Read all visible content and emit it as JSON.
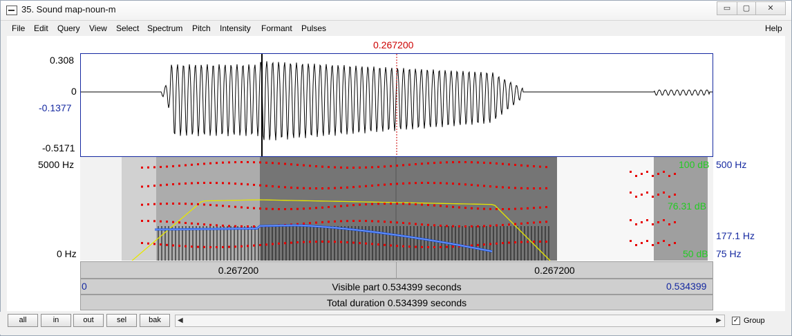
{
  "window": {
    "title": "35. Sound map-noun-m",
    "minimize_label": "▭",
    "maximize_label": "▢",
    "close_label": "✕"
  },
  "menu": {
    "items": [
      "File",
      "Edit",
      "Query",
      "View",
      "Select",
      "Spectrum",
      "Pitch",
      "Intensity",
      "Formant",
      "Pulses"
    ],
    "help": "Help"
  },
  "cursor": {
    "time_label": "0.267200",
    "color": "#cc0000"
  },
  "waveform": {
    "y_top": "0.308",
    "y_zero": "0",
    "y_cursor": "-0.1377",
    "y_bottom": "-0.5171"
  },
  "spectrogram": {
    "freq_top": "5000 Hz",
    "freq_bottom": "0 Hz",
    "intensity_top": "100 dB",
    "intensity_cursor": "76.31 dB",
    "intensity_bottom": "50 dB",
    "pitch_top": "500 Hz",
    "pitch_cursor": "177.1 Hz",
    "pitch_bottom": "75 Hz",
    "colors": {
      "pitch": "#1a55e6",
      "intensity": "#e6e600",
      "formant": "#e60000",
      "pitch_label": "#1428a0",
      "intensity_label": "#22cc22"
    }
  },
  "timebars": {
    "left_segment": "0.267200",
    "right_segment": "0.267200",
    "visible_start": "0",
    "visible_end": "0.534399",
    "visible_label": "Visible part 0.534399 seconds",
    "total_label": "Total duration 0.534399 seconds"
  },
  "controls": {
    "buttons": [
      "all",
      "in",
      "out",
      "sel",
      "bak"
    ],
    "group_label": "Group",
    "group_checked": "✓"
  }
}
